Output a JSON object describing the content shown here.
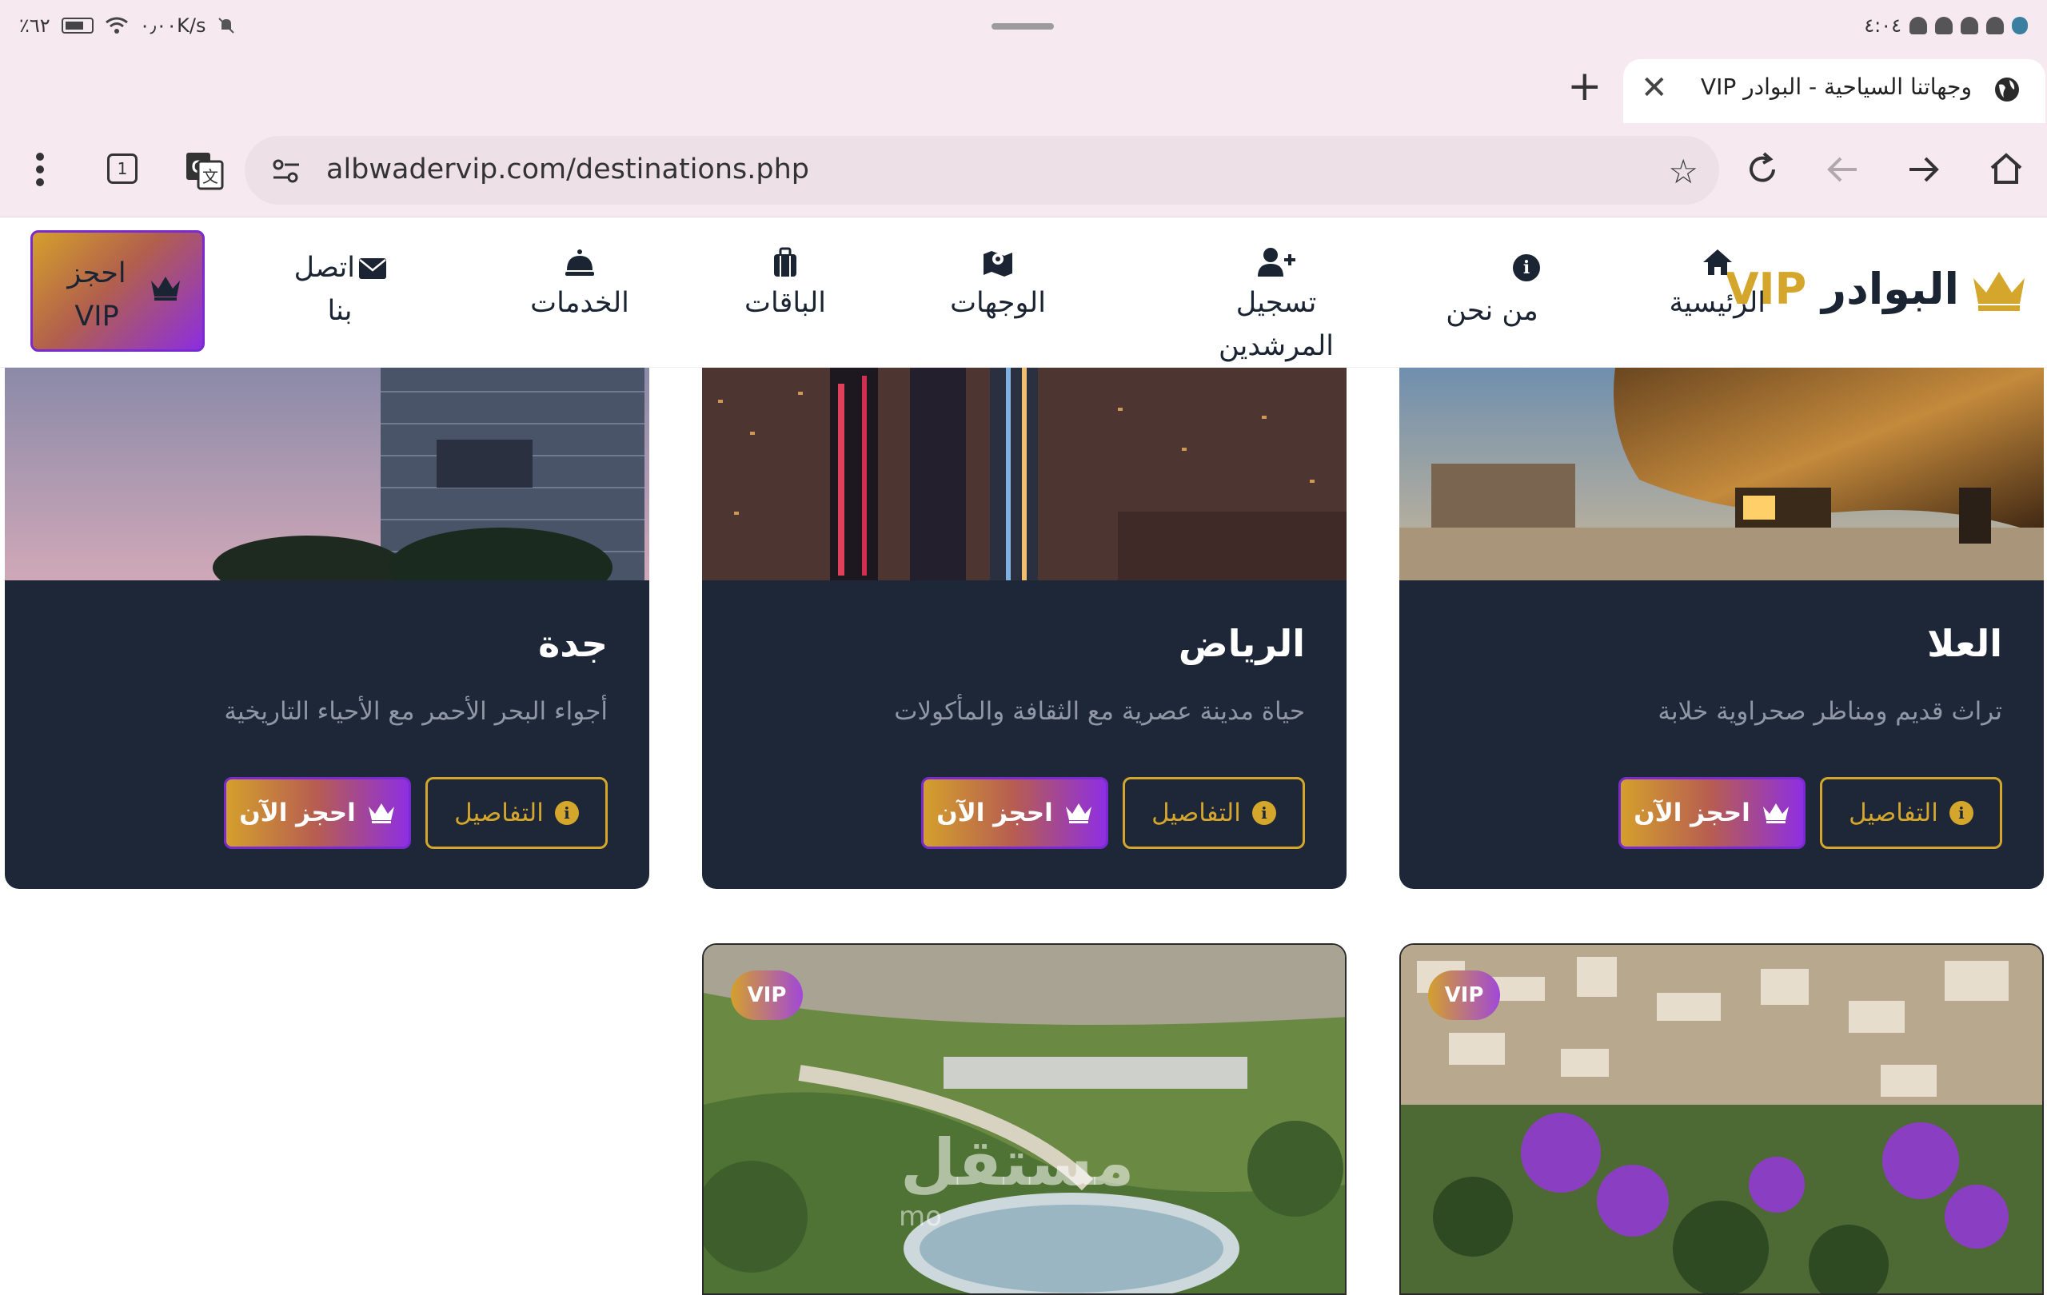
{
  "status_bar": {
    "battery": "٪٦٢",
    "net_speed": "٠٫٠٠K/s",
    "time": "٤:٠٤"
  },
  "browser": {
    "tab_title": "وجهاتنا السياحية - البوادر VIP",
    "url": "albwadervip.com/destinations.php",
    "tab_count": "1"
  },
  "site": {
    "brand_name": "البوادر",
    "brand_vip": "VIP",
    "nav": [
      {
        "label": "الرئيسية",
        "icon": "home-icon"
      },
      {
        "label": "من نحن",
        "icon": "info-icon"
      },
      {
        "label": "تسجيل المرشدين",
        "icon": "user-plus-icon"
      },
      {
        "label": "الوجهات",
        "icon": "map-marker-icon"
      },
      {
        "label": "الباقات",
        "icon": "suitcase-icon"
      },
      {
        "label": "الخدمات",
        "icon": "concierge-bell-icon"
      },
      {
        "label": "اتصل بنا",
        "icon": "envelope-icon"
      }
    ],
    "book_button": "احجز VIP"
  },
  "destinations": [
    {
      "name": "العلا",
      "description": "تراث قديم ومناظر صحراوية خلابة",
      "details_label": "التفاصيل",
      "book_label": "احجز الآن"
    },
    {
      "name": "الرياض",
      "description": "حياة مدينة عصرية مع الثقافة والمأكولات",
      "details_label": "التفاصيل",
      "book_label": "احجز الآن"
    },
    {
      "name": "جدة",
      "description": "أجواء البحر الأحمر مع الأحياء التاريخية",
      "details_label": "التفاصيل",
      "book_label": "احجز الآن"
    }
  ],
  "next_row": [
    {
      "badge": "VIP"
    },
    {
      "badge": "VIP"
    }
  ],
  "watermark": {
    "text": "مستقل",
    "sub": "mo"
  },
  "colors": {
    "gold": "#d4a72c",
    "purple": "#8e2fe2",
    "card_bg": "#1e2738",
    "navy": "#1b2433"
  }
}
